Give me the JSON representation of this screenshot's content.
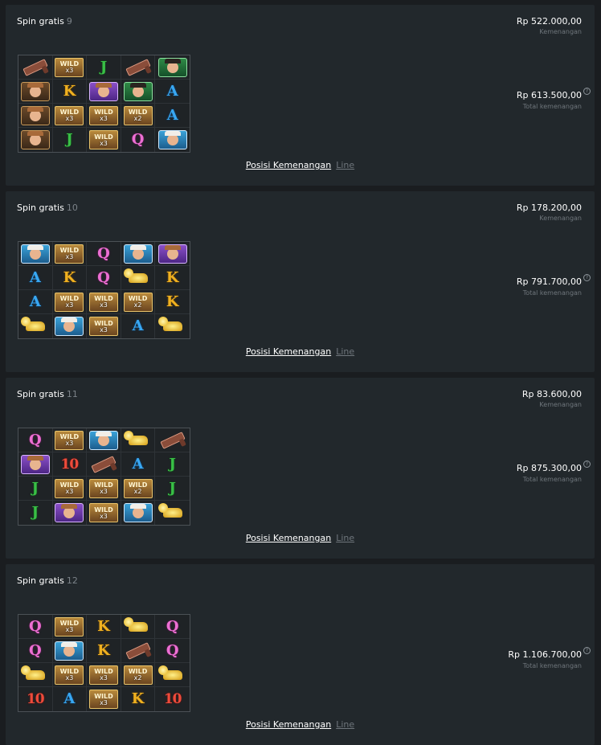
{
  "panels": [
    {
      "title": "Spin gratis",
      "number": "9",
      "win_amount": "Rp 522.000,00",
      "win_label": "Kemenangan",
      "total_amount": "Rp 613.500,00",
      "total_label": "Total kemenangan",
      "help_icon": "question-circle-icon",
      "link_primary": "Posisi Kemenangan",
      "link_secondary": "Line",
      "grid": [
        [
          "gun",
          "wild:x3",
          "J",
          "gun",
          "bandit-green"
        ],
        [
          "cowboy-brown",
          "K",
          "cowgirl-purple",
          "bandit-green",
          "A"
        ],
        [
          "cowboy-brown",
          "wild:x3",
          "wild:x3",
          "wild:x2",
          "A"
        ],
        [
          "cowboy-brown",
          "J",
          "wild:x3",
          "Q",
          "cowgirl-blue"
        ]
      ]
    },
    {
      "title": "Spin gratis",
      "number": "10",
      "win_amount": "Rp 178.200,00",
      "win_label": "Kemenangan",
      "total_amount": "Rp 791.700,00",
      "total_label": "Total kemenangan",
      "help_icon": "question-circle-icon",
      "link_primary": "Posisi Kemenangan",
      "link_secondary": "Line",
      "grid": [
        [
          "cowgirl-blue",
          "wild:x3",
          "Q",
          "cowgirl-blue",
          "cowgirl-purple"
        ],
        [
          "A",
          "K",
          "Q",
          "gold",
          "K"
        ],
        [
          "A",
          "wild:x3",
          "wild:x3",
          "wild:x2",
          "K"
        ],
        [
          "gold",
          "cowgirl-blue",
          "wild:x3",
          "A",
          "gold"
        ]
      ]
    },
    {
      "title": "Spin gratis",
      "number": "11",
      "win_amount": "Rp 83.600,00",
      "win_label": "Kemenangan",
      "total_amount": "Rp 875.300,00",
      "total_label": "Total kemenangan",
      "help_icon": "question-circle-icon",
      "link_primary": "Posisi Kemenangan",
      "link_secondary": "Line",
      "grid": [
        [
          "Q",
          "wild:x3",
          "cowgirl-blue",
          "gold",
          "gun"
        ],
        [
          "cowgirl-purple",
          "10",
          "gun",
          "A",
          "J"
        ],
        [
          "J",
          "wild:x3",
          "wild:x3",
          "wild:x2",
          "J"
        ],
        [
          "J",
          "cowgirl-purple",
          "wild:x3",
          "cowgirl-blue",
          "gold"
        ]
      ]
    },
    {
      "title": "Spin gratis",
      "number": "12",
      "win_amount": "",
      "win_label": "",
      "total_amount": "Rp 1.106.700,00",
      "total_label": "Total kemenangan",
      "help_icon": "question-circle-icon",
      "link_primary": "Posisi Kemenangan",
      "link_secondary": "Line",
      "grid": [
        [
          "Q",
          "wild:x3",
          "K",
          "gold",
          "Q"
        ],
        [
          "Q",
          "cowgirl-blue",
          "K",
          "gun",
          "Q"
        ],
        [
          "gold",
          "wild:x3",
          "wild:x3",
          "wild:x2",
          "gold"
        ],
        [
          "10",
          "A",
          "wild:x3",
          "K",
          "10"
        ]
      ]
    }
  ],
  "colors": {
    "page_bg": "#1a1d20",
    "panel_bg": "#22282c",
    "muted_text": "#6f767c"
  }
}
